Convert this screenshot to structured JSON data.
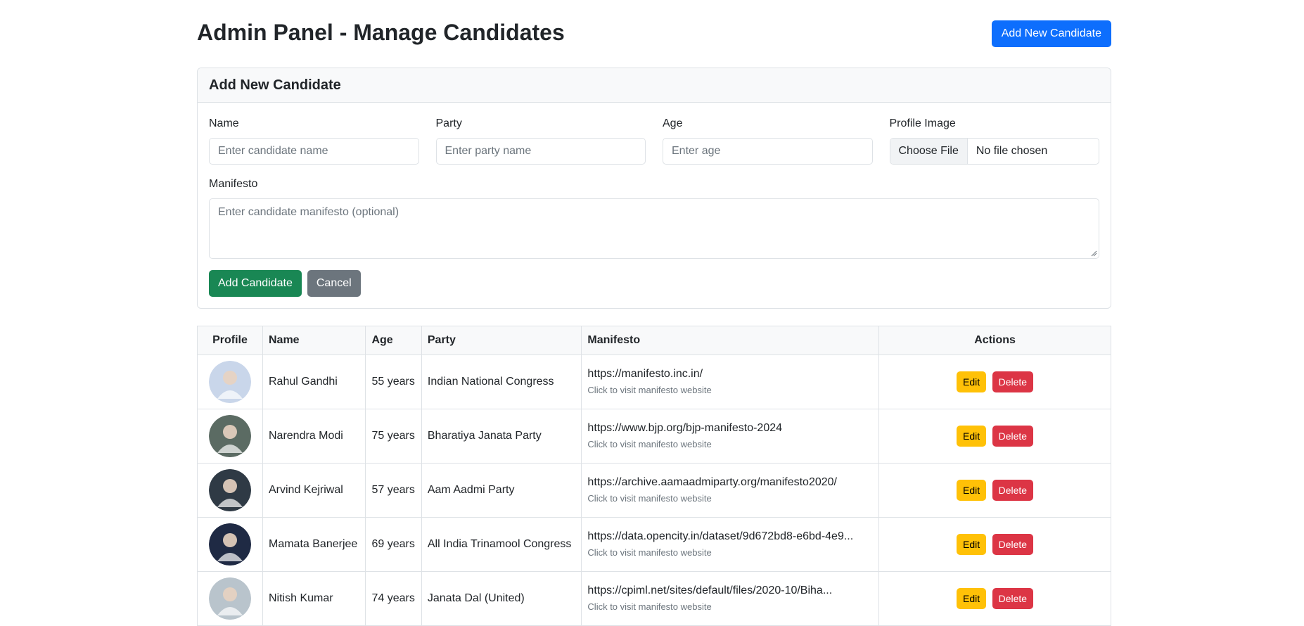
{
  "header": {
    "title": "Admin Panel - Manage Candidates",
    "add_button": "Add New Candidate"
  },
  "form": {
    "title": "Add New Candidate",
    "name_label": "Name",
    "name_placeholder": "Enter candidate name",
    "party_label": "Party",
    "party_placeholder": "Enter party name",
    "age_label": "Age",
    "age_placeholder": "Enter age",
    "image_label": "Profile Image",
    "choose_file": "Choose File",
    "no_file": "No file chosen",
    "manifesto_label": "Manifesto",
    "manifesto_placeholder": "Enter candidate manifesto (optional)",
    "submit": "Add Candidate",
    "cancel": "Cancel"
  },
  "table": {
    "columns": [
      "Profile",
      "Name",
      "Age",
      "Party",
      "Manifesto",
      "Actions"
    ],
    "manifesto_hint": "Click to visit manifesto website",
    "edit_label": "Edit",
    "delete_label": "Delete",
    "rows": [
      {
        "name": "Rahul Gandhi",
        "age": "55 years",
        "party": "Indian National Congress",
        "manifesto": "https://manifesto.inc.in/",
        "avatar_color": "#c9d6ea"
      },
      {
        "name": "Narendra Modi",
        "age": "75 years",
        "party": "Bharatiya Janata Party",
        "manifesto": "https://www.bjp.org/bjp-manifesto-2024",
        "avatar_color": "#5b6b63"
      },
      {
        "name": "Arvind Kejriwal",
        "age": "57 years",
        "party": "Aam Aadmi Party",
        "manifesto": "https://archive.aamaadmiparty.org/manifesto2020/",
        "avatar_color": "#2f3a45"
      },
      {
        "name": "Mamata Banerjee",
        "age": "69 years",
        "party": "All India Trinamool Congress",
        "manifesto": "https://data.opencity.in/dataset/9d672bd8-e6bd-4e9...",
        "avatar_color": "#1f2a44"
      },
      {
        "name": "Nitish Kumar",
        "age": "74 years",
        "party": "Janata Dal (United)",
        "manifesto": "https://cpiml.net/sites/default/files/2020-10/Biha...",
        "avatar_color": "#b9c4cc"
      }
    ]
  }
}
